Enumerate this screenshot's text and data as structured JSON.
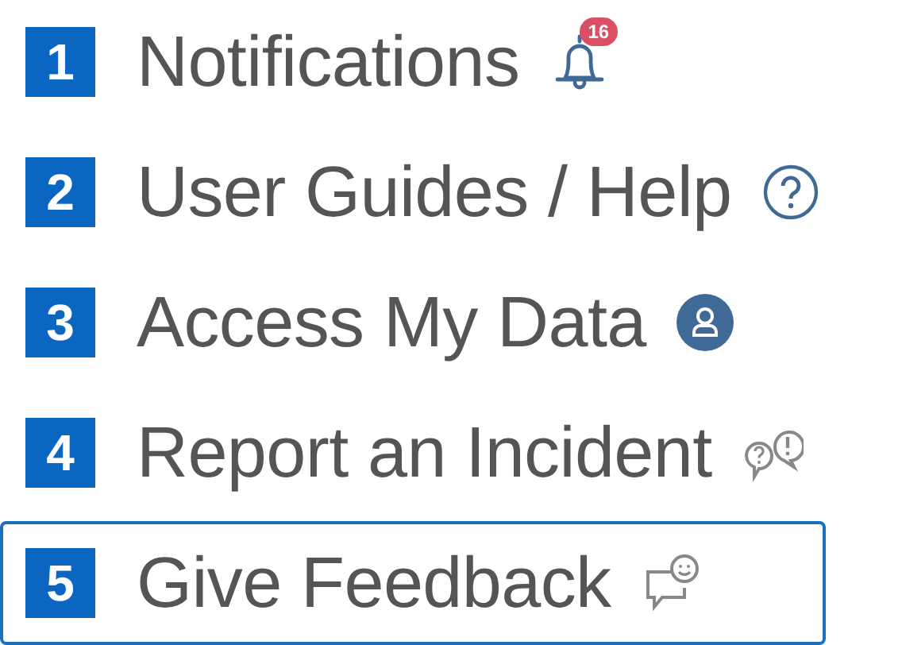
{
  "menu": [
    {
      "number": "1",
      "label": "Notifications",
      "badge": "16",
      "selected": false
    },
    {
      "number": "2",
      "label": "User Guides / Help",
      "selected": false
    },
    {
      "number": "3",
      "label": "Access My Data",
      "selected": false
    },
    {
      "number": "4",
      "label": "Report an Incident",
      "selected": false
    },
    {
      "number": "5",
      "label": "Give Feedback",
      "selected": true
    }
  ]
}
